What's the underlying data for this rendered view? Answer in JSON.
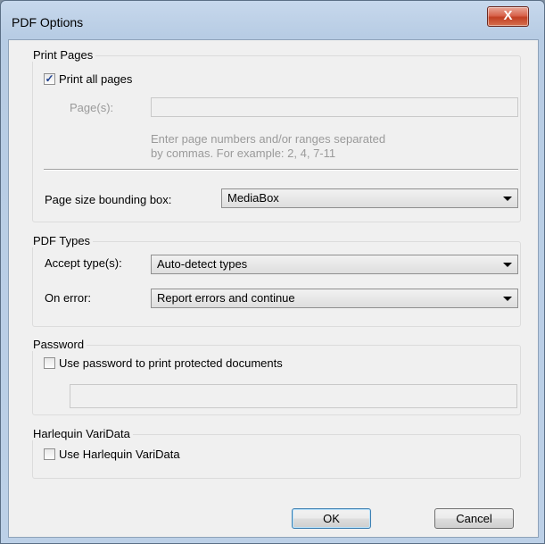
{
  "window": {
    "title": "PDF Options",
    "close_glyph": "X"
  },
  "print_pages": {
    "legend": "Print Pages",
    "print_all_label": "Print all pages",
    "print_all_checked": true,
    "pages_label": "Page(s):",
    "pages_value": "",
    "hint_line1": "Enter page numbers and/or ranges separated",
    "hint_line2": "by commas.  For example: 2, 4, 7-11",
    "bbox_label": "Page size bounding box:",
    "bbox_value": "MediaBox"
  },
  "pdf_types": {
    "legend": "PDF Types",
    "accept_label": "Accept type(s):",
    "accept_value": "Auto-detect types",
    "on_error_label": "On error:",
    "on_error_value": "Report errors and continue"
  },
  "password": {
    "legend": "Password",
    "use_label": "Use password to print protected documents",
    "use_checked": false,
    "value": ""
  },
  "varidata": {
    "legend": "Harlequin VariData",
    "use_label": "Use Harlequin VariData",
    "use_checked": false
  },
  "buttons": {
    "ok": "OK",
    "cancel": "Cancel"
  }
}
